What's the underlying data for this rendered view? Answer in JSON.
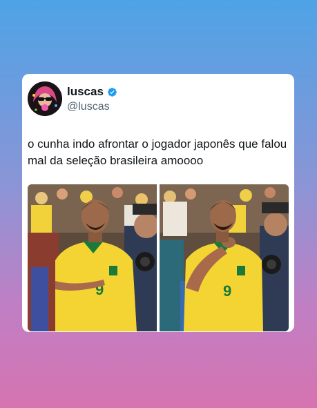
{
  "tweet": {
    "display_name": "luscas",
    "handle": "@luscas",
    "verified_icon": "verified-badge-icon",
    "text": "o cunha indo afrontar o jogador japonês que falou mal da seleção brasileira amoooo",
    "photos": [
      {
        "description_icon": "player-photo-left"
      },
      {
        "description_icon": "player-photo-right"
      }
    ]
  },
  "colors": {
    "background_top": "#4ea3e6",
    "background_bottom": "#d673b0",
    "card": "#ffffff",
    "verified": "#1d9bf0",
    "text": "#0f1419",
    "handle": "#536471",
    "jersey": "#f3d433"
  }
}
